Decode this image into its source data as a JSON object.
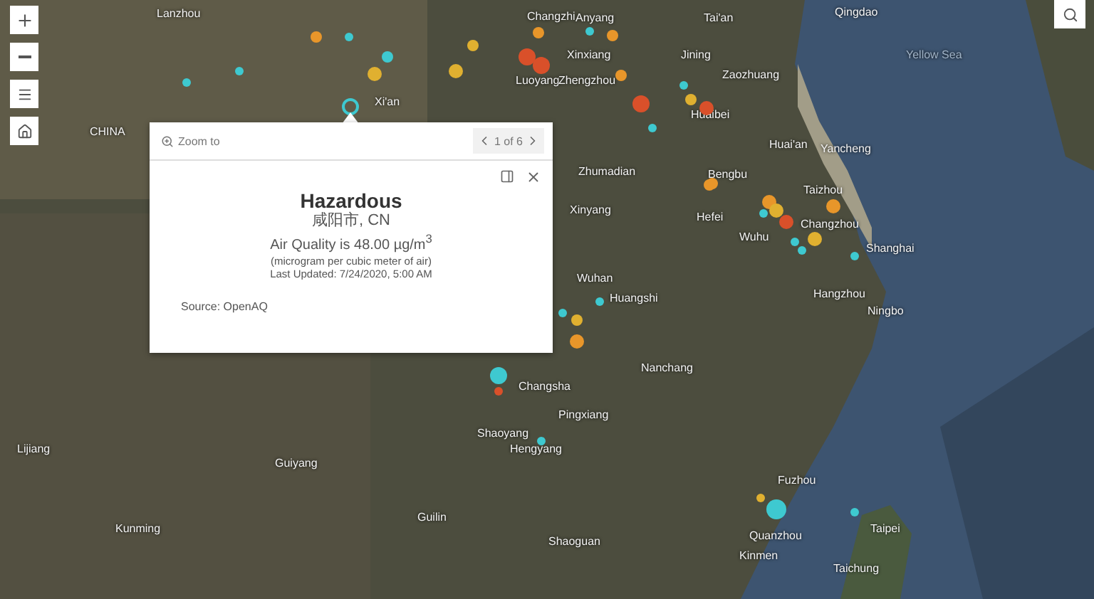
{
  "map": {
    "place_labels": [
      {
        "text": "Lanzhou"
      },
      {
        "text": "Changzhi"
      },
      {
        "text": "Anyang"
      },
      {
        "text": "Tai'an"
      },
      {
        "text": "Qingdao"
      },
      {
        "text": "Xinxiang"
      },
      {
        "text": "Jining"
      },
      {
        "text": "Yellow Sea"
      },
      {
        "text": "Zaozhuang"
      },
      {
        "text": "Luoyang"
      },
      {
        "text": "Zhengzhou"
      },
      {
        "text": "Xi'an"
      },
      {
        "text": "Huaibei"
      },
      {
        "text": "CHINA"
      },
      {
        "text": "Huai'an"
      },
      {
        "text": "Yancheng"
      },
      {
        "text": "Zhumadian"
      },
      {
        "text": "Bengbu"
      },
      {
        "text": "Taizhou"
      },
      {
        "text": "Xinyang"
      },
      {
        "text": "Hefei"
      },
      {
        "text": "Changzhou"
      },
      {
        "text": "Wuhu"
      },
      {
        "text": "Shanghai"
      },
      {
        "text": "Wuhan"
      },
      {
        "text": "Huangshi"
      },
      {
        "text": "Hangzhou"
      },
      {
        "text": "Ningbo"
      },
      {
        "text": "Nanchang"
      },
      {
        "text": "Changsha"
      },
      {
        "text": "Pingxiang"
      },
      {
        "text": "Lijiang"
      },
      {
        "text": "Shaoyang"
      },
      {
        "text": "Hengyang"
      },
      {
        "text": "Guiyang"
      },
      {
        "text": "Fuzhou"
      },
      {
        "text": "Kunming"
      },
      {
        "text": "Guilin"
      },
      {
        "text": "Shaoguan"
      },
      {
        "text": "Quanzhou"
      },
      {
        "text": "Taipei"
      },
      {
        "text": "Kinmen"
      },
      {
        "text": "Taichung"
      }
    ],
    "markers": [
      {
        "color": "#e8962a"
      },
      {
        "color": "#3ec9d0"
      },
      {
        "color": "#3ec9d0"
      },
      {
        "color": "#e0b030"
      },
      {
        "color": "#d9502a"
      },
      {
        "color": "#d9502a"
      },
      {
        "color": "#e8962a"
      },
      {
        "color": "#3ec9d0"
      },
      {
        "color": "#e0b030"
      },
      {
        "color": "#e8962a"
      },
      {
        "color": "#d9502a"
      },
      {
        "color": "#e0b030"
      },
      {
        "color": "#3ec9d0"
      },
      {
        "color": "#3ec9d0"
      },
      {
        "color": "#e8962a"
      },
      {
        "color": "#e0b030"
      },
      {
        "color": "#d9502a"
      },
      {
        "color": "#e8962a"
      },
      {
        "color": "#e8962a"
      },
      {
        "color": "#3ec9d0"
      },
      {
        "color": "#3ec9d0"
      },
      {
        "color": "#e8962a"
      },
      {
        "color": "#e0b030"
      },
      {
        "color": "#3ec9d0"
      },
      {
        "color": "#3ec9d0"
      },
      {
        "color": "#e8962a"
      },
      {
        "color": "#e0b030"
      },
      {
        "color": "#3ec9d0"
      },
      {
        "color": "#d9502a"
      },
      {
        "color": "#3ec9d0"
      },
      {
        "color": "#e0b030"
      },
      {
        "color": "#3ec9d0"
      },
      {
        "color": "#3ec9d0"
      },
      {
        "color": "#e8962a"
      },
      {
        "color": "#3ec9d0"
      },
      {
        "color": "#3ec9d0"
      },
      {
        "color": "#d9502a"
      },
      {
        "color": "#3ec9d0"
      },
      {
        "color": "#e0b030"
      },
      {
        "color": "#3ec9d0"
      }
    ]
  },
  "popup": {
    "zoom_to": "Zoom to",
    "pager": "1 of 6",
    "title": "Hazardous",
    "location": "咸阳市, CN",
    "reading": "Air Quality is 48.00 µg/m$^{3}$",
    "unit_note": "(microgram per cubic meter of air)",
    "updated": "Last Updated: 7/24/2020, 5:00 AM",
    "source": "Source: OpenAQ"
  }
}
